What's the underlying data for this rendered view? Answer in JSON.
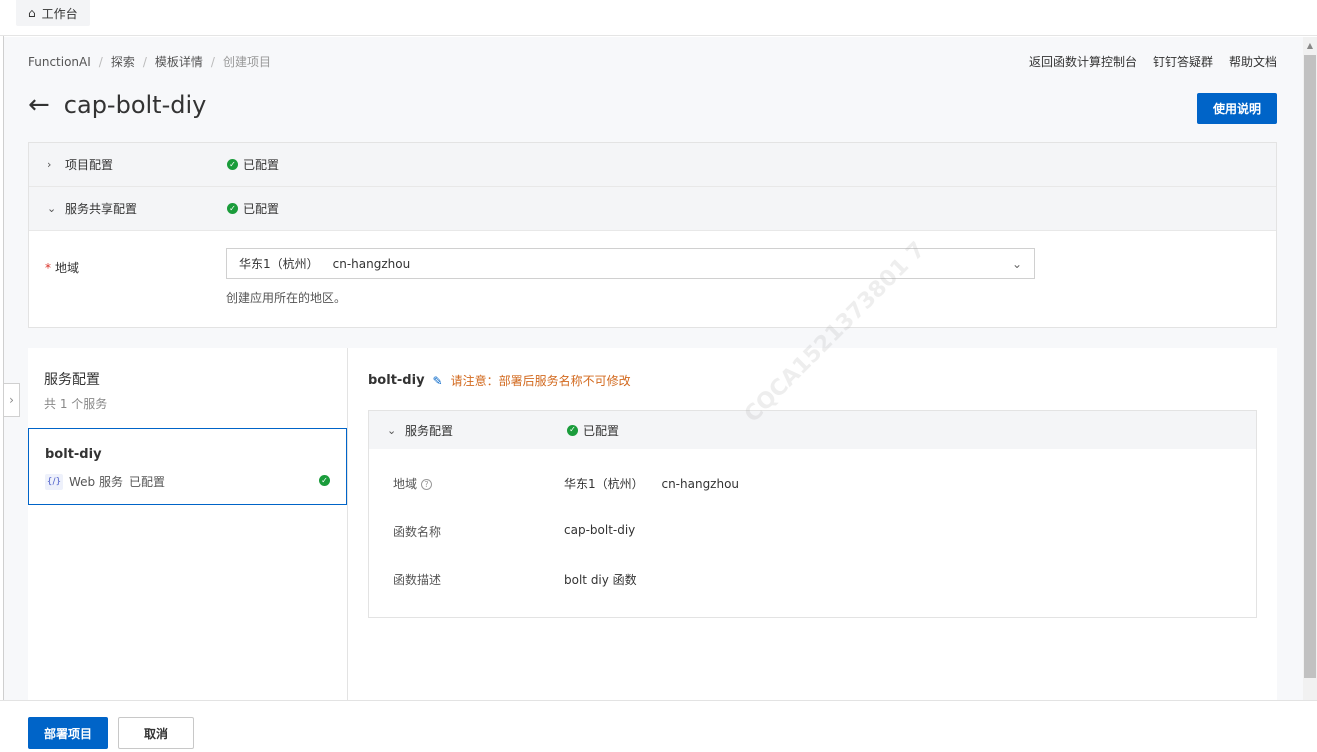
{
  "topbar": {
    "workbench_label": "工作台"
  },
  "breadcrumb": [
    "FunctionAI",
    "探索",
    "模板详情",
    "创建项目"
  ],
  "top_links": [
    "返回函数计算控制台",
    "钉钉答疑群",
    "帮助文档"
  ],
  "page": {
    "title": "cap-bolt-diy",
    "help_button": "使用说明"
  },
  "config": {
    "project_row": {
      "label": "项目配置",
      "status": "已配置"
    },
    "shared_row": {
      "label": "服务共享配置",
      "status": "已配置"
    },
    "region": {
      "required_mark": "*",
      "label": "地域",
      "value_name": "华东1（杭州）",
      "value_code": "cn-hangzhou",
      "help": "创建应用所在的地区。"
    }
  },
  "services": {
    "title": "服务配置",
    "count": "共 1 个服务",
    "items": [
      {
        "name": "bolt-diy",
        "icon_text": "{/}",
        "type": "Web 服务",
        "status": "已配置"
      }
    ]
  },
  "service_detail": {
    "name": "bolt-diy",
    "warning": "请注意：部署后服务名称不可修改",
    "section_label": "服务配置",
    "section_status": "已配置",
    "fields": {
      "region_label": "地域",
      "region_value_name": "华东1（杭州）",
      "region_value_code": "cn-hangzhou",
      "fn_name_label": "函数名称",
      "fn_name_value": "cap-bolt-diy",
      "fn_desc_label": "函数描述",
      "fn_desc_value": "bolt diy 函数"
    }
  },
  "watermark": "CQCA1521373801 7",
  "footer": {
    "deploy": "部署项目",
    "cancel": "取消"
  },
  "colors": {
    "primary": "#0064c8",
    "success": "#1a9c3b",
    "warning": "#d2691e",
    "required": "#d93026"
  }
}
